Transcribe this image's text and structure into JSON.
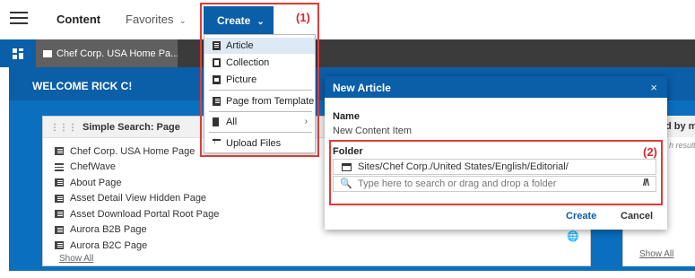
{
  "topbar": {
    "nav_content": "Content",
    "nav_favorites": "Favorites",
    "create_label": "Create",
    "annotation_1": "(1)"
  },
  "tabbar": {
    "page_tab": "Chef Corp. USA Home Pa..."
  },
  "welcome": "WELCOME RICK C!",
  "create_menu": {
    "items": [
      {
        "label": "Article",
        "icon": "article-icon",
        "highlighted": true
      },
      {
        "label": "Collection",
        "icon": "collection-icon"
      },
      {
        "label": "Picture",
        "icon": "picture-icon"
      },
      {
        "label": "Page from Template",
        "icon": "template-icon"
      },
      {
        "label": "All",
        "icon": "all-icon",
        "submenu": true
      },
      {
        "label": "Upload Files",
        "icon": "upload-icon"
      }
    ]
  },
  "simple_search": {
    "title": "Simple Search: Page",
    "items": [
      {
        "label": "Chef Corp. USA Home Page",
        "icon": "page-icon"
      },
      {
        "label": "ChefWave",
        "icon": "menu-icon"
      },
      {
        "label": "About Page",
        "icon": "page-icon"
      },
      {
        "label": "Asset Detail View Hidden Page",
        "icon": "page-icon"
      },
      {
        "label": "Asset Download Portal Root Page",
        "icon": "page-icon"
      },
      {
        "label": "Aurora B2B Page",
        "icon": "page-icon"
      },
      {
        "label": "Aurora B2C Page",
        "icon": "page-icon"
      }
    ],
    "show_all": "Show All"
  },
  "right_panel": {
    "title_fragment": "d by me",
    "subtitle_fragment": "h results",
    "show_all": "Show All"
  },
  "modal": {
    "title": "New Article",
    "close": "×",
    "name_label": "Name",
    "name_value": "New Content Item",
    "folder_label": "Folder",
    "annotation_2": "(2)",
    "folder_path": "Sites/Chef Corp./United States/English/Editorial/",
    "search_placeholder": "Type here to search or drag and drop a folder",
    "create_button": "Create",
    "cancel_button": "Cancel"
  },
  "colors": {
    "brand_blue": "#0b5ea8",
    "annotation_red": "#e03b3b",
    "tabbar_dark": "#3b3b3b"
  }
}
